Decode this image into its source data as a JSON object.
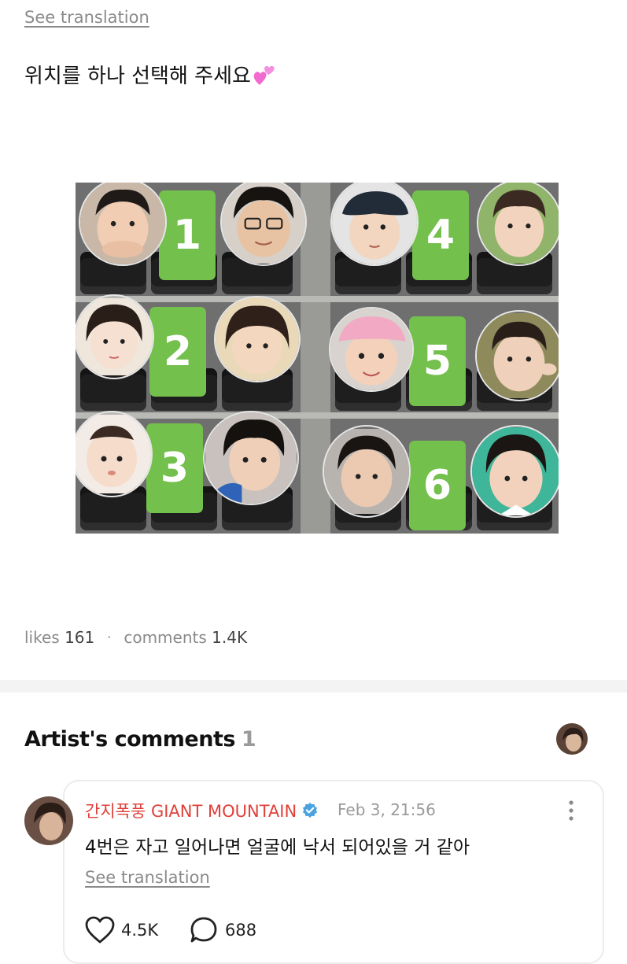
{
  "post": {
    "see_translation": "See translation",
    "text": "위치를 하나 선택해 주세요"
  },
  "chart": {
    "numbers": [
      "1",
      "2",
      "3",
      "4",
      "5",
      "6"
    ]
  },
  "stats": {
    "likes_label": "likes",
    "likes_value": "161",
    "comments_label": "comments",
    "comments_value": "1.4K"
  },
  "artist_comments": {
    "title": "Artist's comments",
    "count": "1",
    "comment": {
      "author": "간지폭풍 GIANT MOUNTAIN",
      "date": "Feb 3, 21:56",
      "body": "4번은 자고 일어나면 얼굴에 낙서 되어있을 거 같아",
      "see_translation": "See translation",
      "likes": "4.5K",
      "replies": "688"
    }
  },
  "colors": {
    "number_box": "#73c04d",
    "author": "#e0403a",
    "verified": "#4aa3df"
  }
}
